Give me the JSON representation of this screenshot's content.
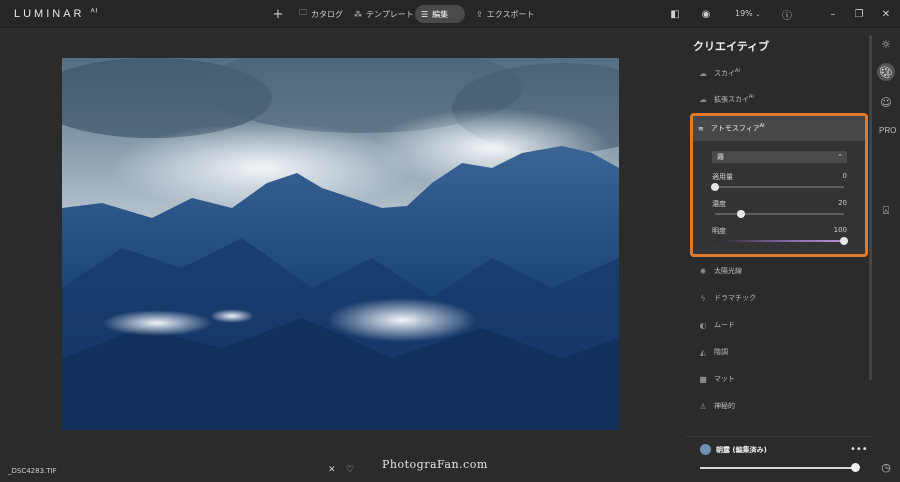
{
  "app": {
    "logo": "LUMINAR",
    "logo_sup": "AI"
  },
  "topbar": {
    "add_icon": "plus-icon",
    "tabs": [
      {
        "label": "カタログ",
        "icon": "folder-icon"
      },
      {
        "label": "テンプレート",
        "icon": "magic-icon"
      },
      {
        "label": "編集",
        "icon": "sliders-icon"
      },
      {
        "label": "エクスポート",
        "icon": "export-icon"
      }
    ],
    "zoom": "19%"
  },
  "photo": {
    "filename": "_DSC4283.TIF"
  },
  "watermark": "PhotograFan.com",
  "panel": {
    "title": "クリエイティブ",
    "items_above": [
      {
        "label": "スカイ",
        "sup": "AI"
      },
      {
        "label": "拡張スカイ",
        "sup": "AI"
      }
    ],
    "atmosphere": {
      "header": "アトモスフィア",
      "header_sup": "AI",
      "select_value": "霧",
      "sliders": [
        {
          "label": "適用量",
          "value": "0",
          "fraction": 0.0
        },
        {
          "label": "濃度",
          "value": "20",
          "fraction": 0.2
        },
        {
          "label": "明度",
          "value": "100",
          "fraction": 1.0
        }
      ]
    },
    "items_below": [
      {
        "label": "太陽光線",
        "icon": "sun-rays-icon"
      },
      {
        "label": "ドラマチック",
        "icon": "bolt-icon"
      },
      {
        "label": "ムード",
        "icon": "mood-icon"
      },
      {
        "label": "階調",
        "icon": "tone-icon"
      },
      {
        "label": "マット",
        "icon": "matte-icon"
      },
      {
        "label": "神秘的",
        "icon": "mystic-icon"
      }
    ]
  },
  "preset": {
    "name": "朝露 (編集済み)",
    "amount": 1.0
  },
  "colors": {
    "accent_highlight": "#e07a2a",
    "panel_bg": "#2b2b2b"
  }
}
